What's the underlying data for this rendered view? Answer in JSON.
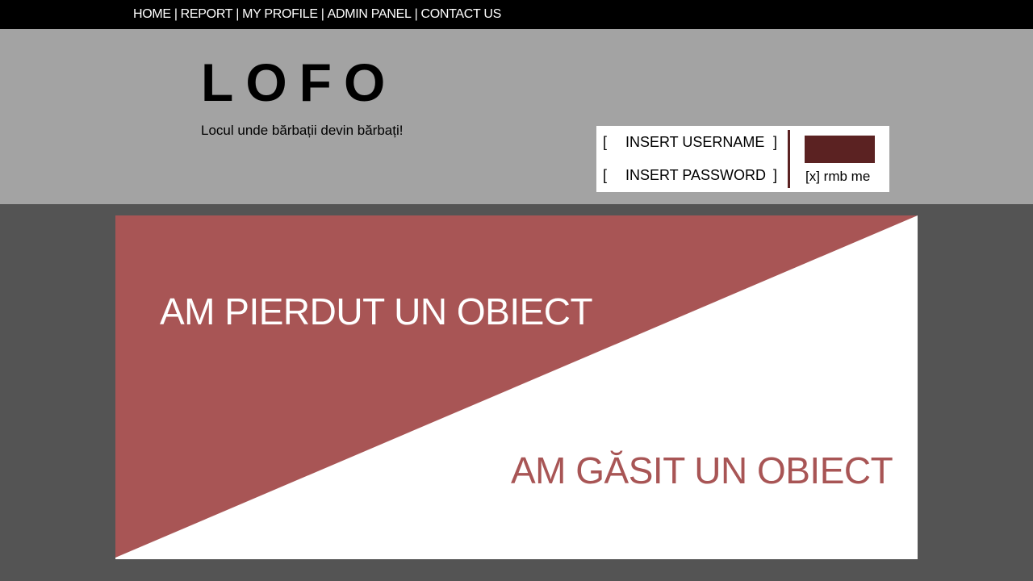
{
  "nav": {
    "items": [
      {
        "label": "HOME"
      },
      {
        "label": "REPORT"
      },
      {
        "label": "MY PROFILE"
      },
      {
        "label": "ADMIN PANEL"
      },
      {
        "label": "CONTACT US"
      }
    ],
    "separator": "|"
  },
  "header": {
    "logo": "LOFO",
    "tagline": "Locul unde bărbații devin bărbați!"
  },
  "login": {
    "bracket_open": "[",
    "bracket_close": "]",
    "username_placeholder": "INSERT USERNAME",
    "password_placeholder": "INSERT PASSWORD",
    "remember_label": "[x] rmb me"
  },
  "main": {
    "lost_label": "AM PIERDUT UN OBIECT",
    "found_label": "AM GĂSIT UN OBIECT"
  },
  "colors": {
    "nav_bg": "#000000",
    "header_bg": "#a3a3a3",
    "page_bg": "#545454",
    "accent": "#a85555",
    "accent_dark": "#5b2222"
  }
}
